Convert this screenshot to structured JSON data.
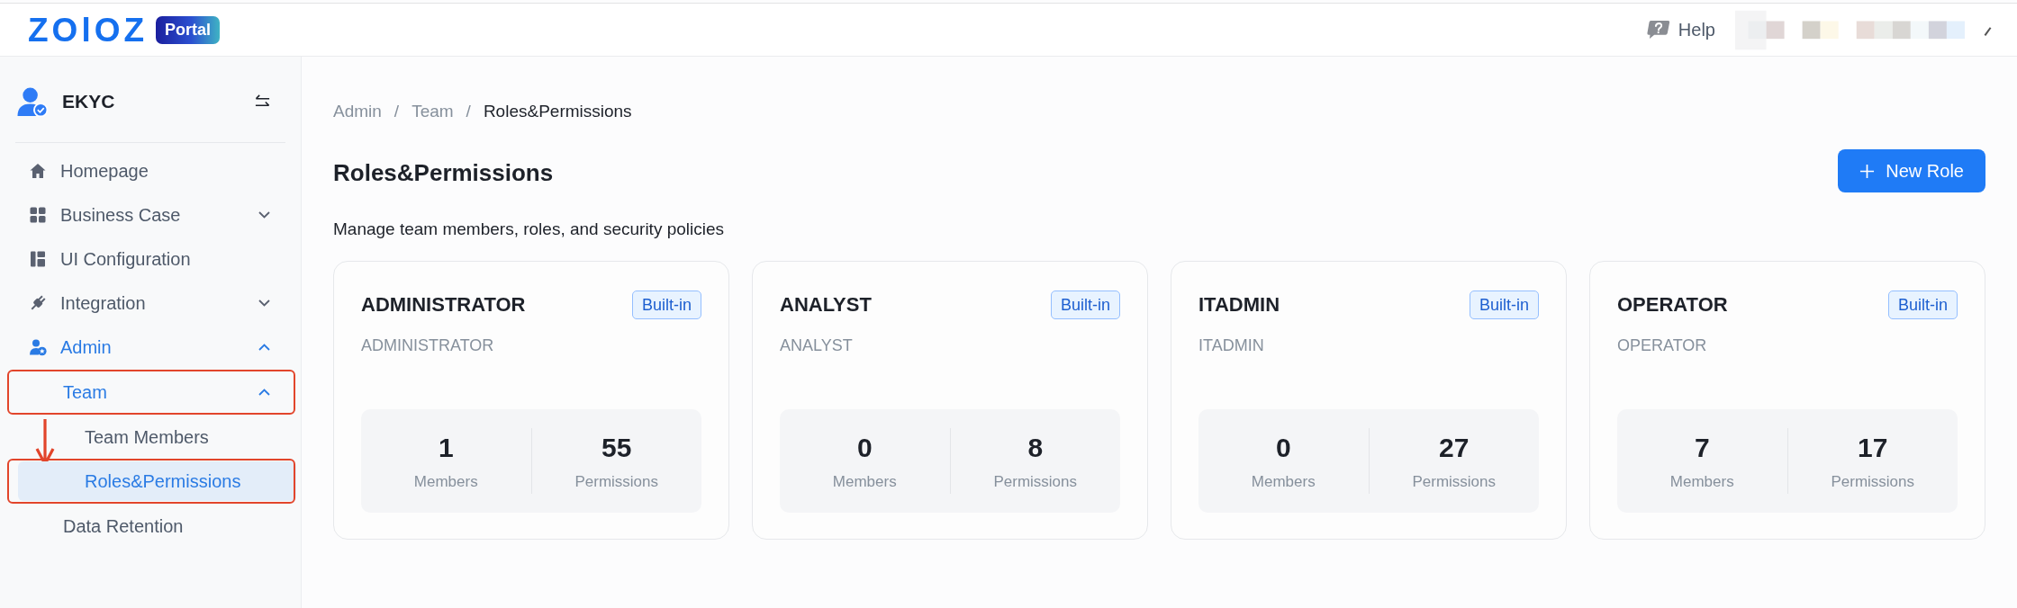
{
  "header": {
    "logo": "ZOlOZ",
    "badge": "Portal",
    "help": "Help"
  },
  "sidebar": {
    "account": {
      "name": "EKYC"
    },
    "items": [
      {
        "kind": "link",
        "label": "Homepage",
        "selected": false,
        "marked": false,
        "arrow": false
      },
      {
        "kind": "group",
        "label": "Business Case",
        "expanded": false,
        "selected": false,
        "marked": false,
        "arrow": false
      },
      {
        "kind": "link",
        "label": "UI Configuration",
        "selected": false,
        "marked": false,
        "arrow": false
      },
      {
        "kind": "group",
        "label": "Integration",
        "expanded": false,
        "selected": false,
        "marked": false,
        "arrow": false
      },
      {
        "kind": "group",
        "label": "Admin",
        "expanded": true,
        "selected": false,
        "marked": false,
        "arrow": false,
        "children": [
          {
            "kind": "group",
            "label": "Team",
            "expanded": true,
            "selected": false,
            "marked": true,
            "arrow": true,
            "children": [
              {
                "kind": "link",
                "label": "Team Members",
                "selected": false,
                "marked": false,
                "arrow": false
              },
              {
                "kind": "link",
                "label": "Roles&Permissions",
                "selected": true,
                "marked": true,
                "arrow": false
              }
            ]
          },
          {
            "kind": "link",
            "label": "Data Retention",
            "selected": false,
            "marked": false,
            "arrow": false
          }
        ]
      }
    ]
  },
  "breadcrumb": [
    {
      "label": "Admin",
      "current": false,
      "separator": "/"
    },
    {
      "label": "Team",
      "current": false,
      "separator": "/"
    },
    {
      "label": "Roles&Permissions",
      "current": true
    }
  ],
  "page": {
    "title": "Roles&Permissions",
    "description": "Manage team members, roles, and security policies",
    "new_button": {
      "label": "New Role"
    }
  },
  "roles": [
    {
      "name": "ADMINISTRATOR",
      "code": "ADMINISTRATOR",
      "badge": "Built-in",
      "stats": [
        {
          "value": "1",
          "label": "Members"
        },
        {
          "value": "55",
          "label": "Permissions"
        }
      ]
    },
    {
      "name": "ANALYST",
      "code": "ANALYST",
      "badge": "Built-in",
      "stats": [
        {
          "value": "0",
          "label": "Members"
        },
        {
          "value": "8",
          "label": "Permissions"
        }
      ]
    },
    {
      "name": "ITADMIN",
      "code": "ITADMIN",
      "badge": "Built-in",
      "stats": [
        {
          "value": "0",
          "label": "Members"
        },
        {
          "value": "27",
          "label": "Permissions"
        }
      ]
    },
    {
      "name": "OPERATOR",
      "code": "OPERATOR",
      "badge": "Built-in",
      "stats": [
        {
          "value": "7",
          "label": "Members"
        },
        {
          "value": "17",
          "label": "Permissions"
        }
      ]
    }
  ]
}
